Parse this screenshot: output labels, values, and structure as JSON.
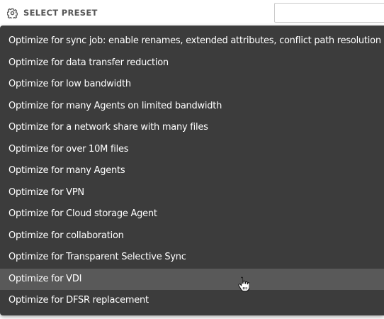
{
  "header": {
    "preset_label": "SELECT PRESET",
    "preset_icon": "gear-icon",
    "search_value": "",
    "search_placeholder": ""
  },
  "menu": {
    "items": [
      {
        "label": "Optimize for sync job: enable renames, extended attributes, conflict path resolution"
      },
      {
        "label": "Optimize for data transfer reduction"
      },
      {
        "label": "Optimize for low bandwidth"
      },
      {
        "label": "Optimize for many Agents on limited bandwidth"
      },
      {
        "label": "Optimize for a network share with many files"
      },
      {
        "label": "Optimize for over 10M files"
      },
      {
        "label": "Optimize for many Agents"
      },
      {
        "label": "Optimize for VPN"
      },
      {
        "label": "Optimize for Cloud storage Agent"
      },
      {
        "label": "Optimize for collaboration"
      },
      {
        "label": "Optimize for Transparent Selective Sync"
      },
      {
        "label": "Optimize for VDI"
      },
      {
        "label": "Optimize for DFSR replacement"
      }
    ],
    "hovered_label": "Optimize for VDI"
  },
  "colors": {
    "menu_background": "#3c3c3c",
    "hover_background": "#595959",
    "menu_text": "#ffffff",
    "header_text": "#565656"
  }
}
